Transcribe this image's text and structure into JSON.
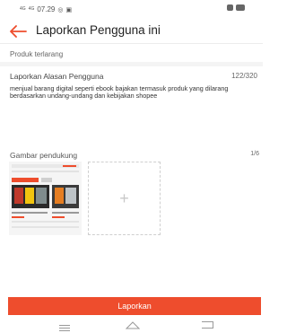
{
  "status_bar": {
    "time": "07.29",
    "signal_label_1": "4G",
    "signal_label_2": "4G"
  },
  "header": {
    "title": "Laporkan Pengguna ini",
    "accent_color": "#ee4d2d"
  },
  "product_section": {
    "label": "Produk terlarang"
  },
  "reason_section": {
    "label": "Laporkan Alasan Pengguna",
    "counter": "122/320",
    "text": "menjual barang digital seperti ebook bajakan termasuk produk yang dilarang berdasarkan undang-undang dan kebijakan shopee"
  },
  "images_section": {
    "label": "Gambar pendukung",
    "counter": "1/6",
    "add_icon": "plus-icon",
    "thumbnail_icon": "screenshot-thumbnail"
  },
  "footer": {
    "submit_label": "Laporkan",
    "submit_color": "#ee4d2d"
  },
  "nav": {
    "icons": [
      "menu-icon",
      "home-icon",
      "back-nav-icon"
    ]
  }
}
